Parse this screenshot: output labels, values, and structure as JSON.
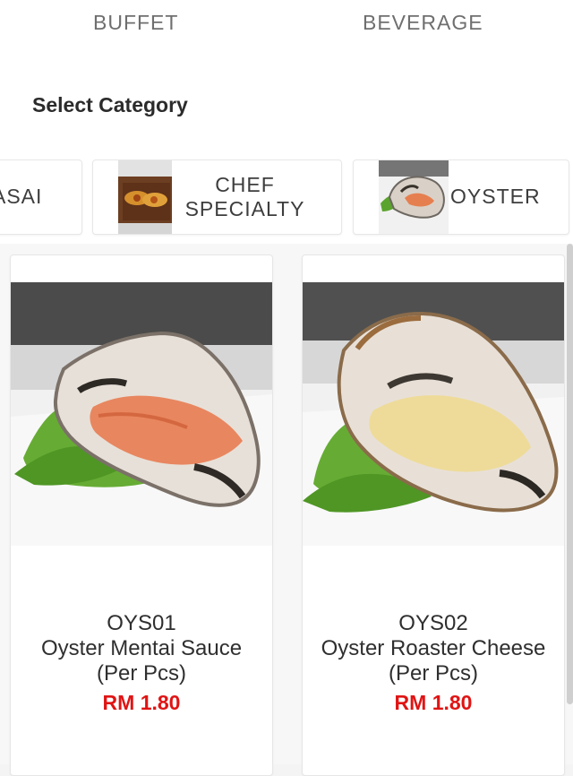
{
  "top_tabs": {
    "buffet": "BUFFET",
    "beverage": "BEVERAGE"
  },
  "section": {
    "title": "Select Category"
  },
  "categories": [
    {
      "label": "ASAI",
      "icon": "category-thumbnail"
    },
    {
      "label": "CHEF SPECIALTY",
      "icon": "chef-specialty-thumbnail"
    },
    {
      "label": "OYSTER",
      "icon": "oyster-thumbnail"
    }
  ],
  "products": [
    {
      "code": "OYS01",
      "name": "Oyster Mentai Sauce (Per Pcs)",
      "price": "RM 1.80",
      "image": "oyster-mentai-photo"
    },
    {
      "code": "OYS02",
      "name": "Oyster Roaster Cheese (Per Pcs)",
      "price": "RM 1.80",
      "image": "oyster-cheese-photo"
    }
  ],
  "colors": {
    "price": "#e01414",
    "text": "#2f2f2f",
    "muted": "#6f6f6f"
  }
}
